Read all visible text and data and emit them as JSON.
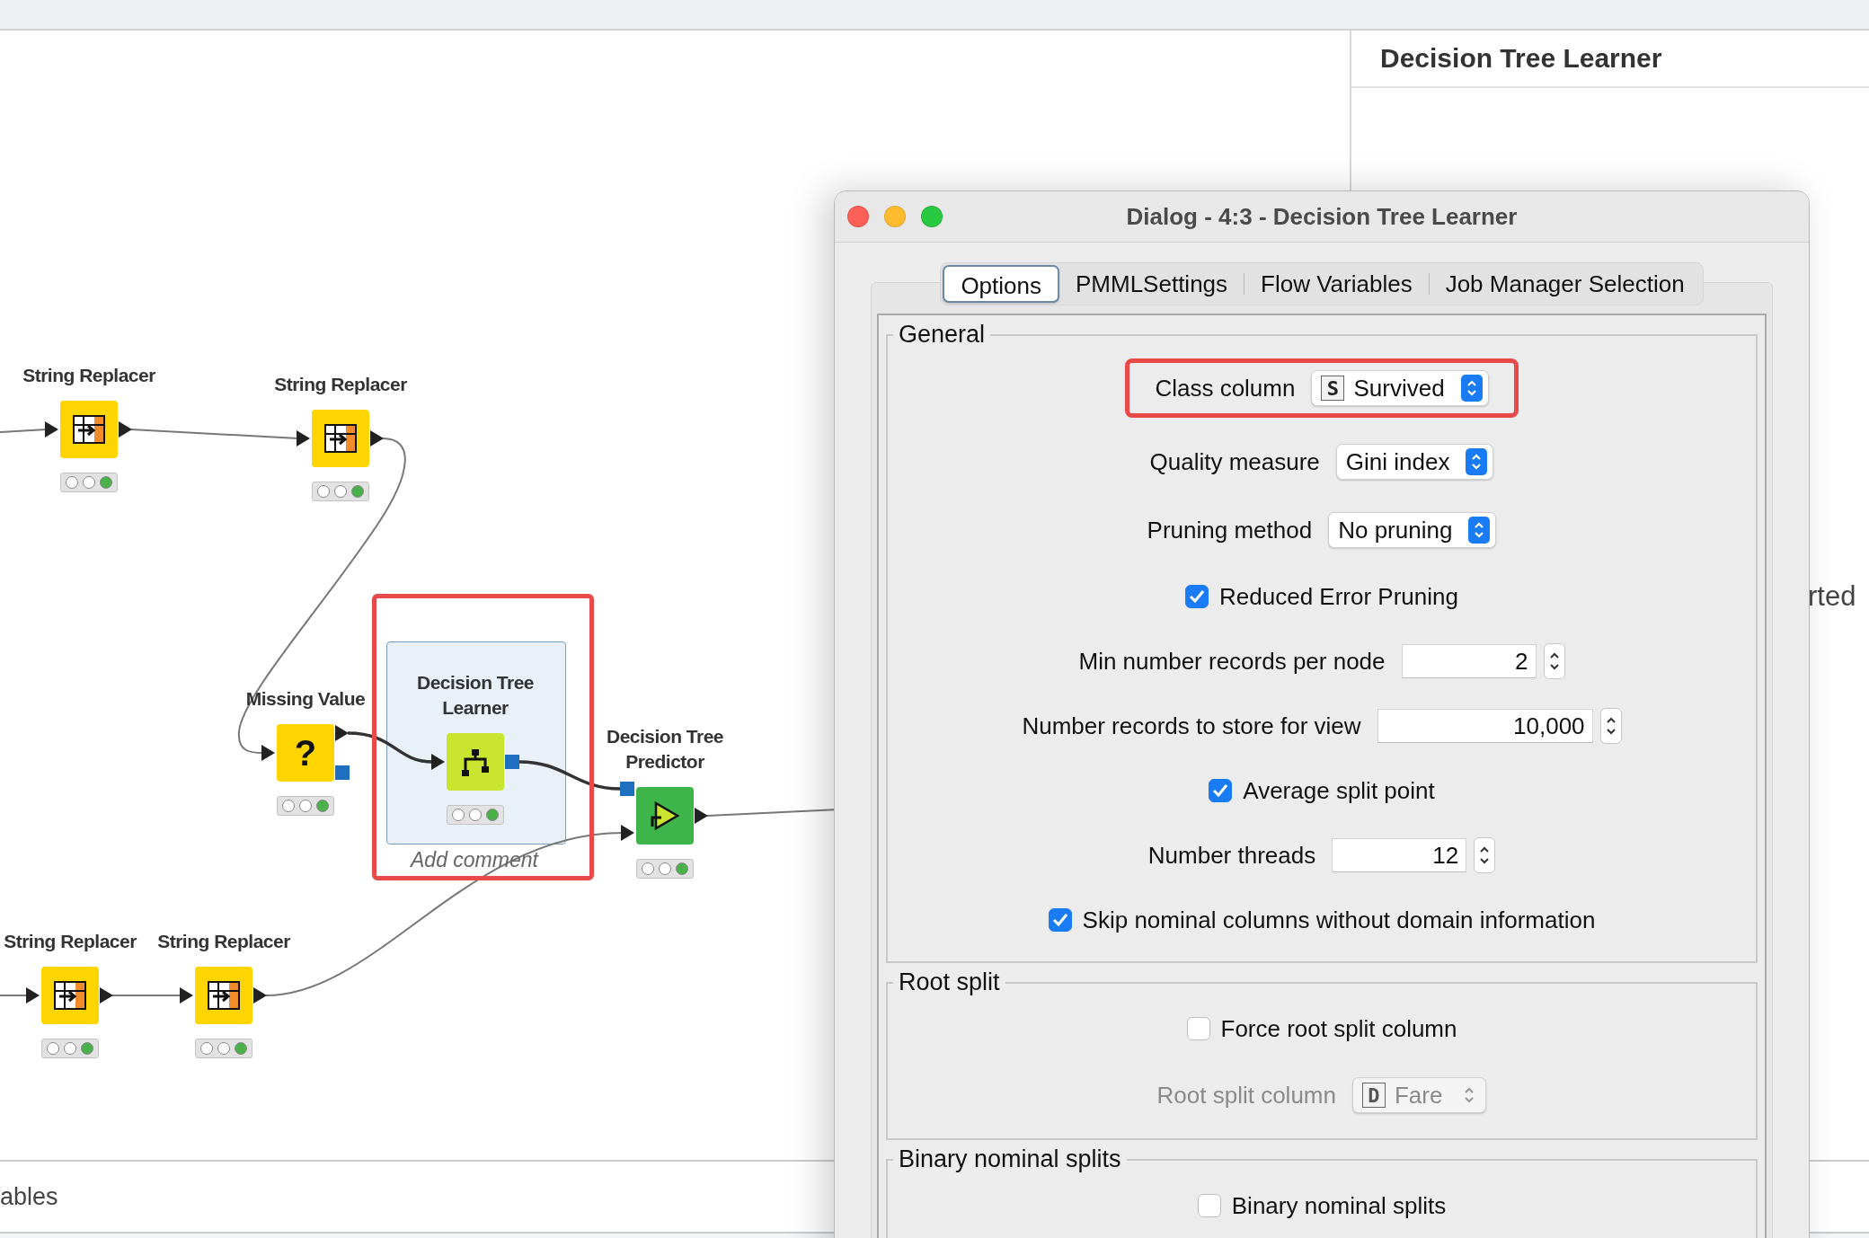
{
  "canvas": {
    "nodes": [
      {
        "kind": "string_replacer",
        "title": "String Replacer",
        "executed": true,
        "selected": false,
        "highlighted": false
      },
      {
        "kind": "string_replacer",
        "title": "String Replacer",
        "executed": true,
        "selected": false,
        "highlighted": false
      },
      {
        "kind": "missing_value",
        "title": "Missing Value",
        "glyph": "?",
        "executed": true,
        "selected": false,
        "highlighted": false
      },
      {
        "kind": "learner",
        "title": "Decision Tree Learner",
        "executed": true,
        "selected": true,
        "highlighted": true,
        "comment_placeholder": "Add comment"
      },
      {
        "kind": "predictor",
        "title": "Decision Tree Predictor",
        "executed": true,
        "selected": false,
        "highlighted": false
      },
      {
        "kind": "string_replacer",
        "title": "String Replacer",
        "executed": true,
        "selected": false,
        "highlighted": false
      },
      {
        "kind": "string_replacer",
        "title": "String Replacer",
        "executed": true,
        "selected": false,
        "highlighted": false
      }
    ]
  },
  "side_panel": {
    "title": "Decision Tree Learner",
    "text": "rted"
  },
  "bottom_panel": {
    "tab": "ables"
  },
  "dialog": {
    "title": "Dialog - 4:3 - Decision Tree Learner",
    "tabs": [
      {
        "label": "Options",
        "selected": true
      },
      {
        "label": "PMMLSettings",
        "selected": false
      },
      {
        "label": "Flow Variables",
        "selected": false
      },
      {
        "label": "Job Manager Selection",
        "selected": false
      }
    ],
    "sections": [
      {
        "title": "General",
        "rows": [
          {
            "kind": "select",
            "label": "Class column",
            "value": "Survived",
            "type_badge": "S",
            "highlighted": true,
            "disabled": false
          },
          {
            "kind": "select",
            "label": "Quality measure",
            "value": "Gini index",
            "highlighted": false,
            "disabled": false
          },
          {
            "kind": "select",
            "label": "Pruning method",
            "value": "No pruning",
            "highlighted": false,
            "disabled": false
          },
          {
            "kind": "checkbox",
            "label": "Reduced Error Pruning",
            "checked": true
          },
          {
            "kind": "spinner",
            "label": "Min number records per node",
            "value": "2"
          },
          {
            "kind": "spinner",
            "label": "Number records to store for view",
            "value": "10,000"
          },
          {
            "kind": "checkbox",
            "label": "Average split point",
            "checked": true
          },
          {
            "kind": "spinner",
            "label": "Number threads",
            "value": "12"
          },
          {
            "kind": "checkbox",
            "label": "Skip nominal columns without domain information",
            "checked": true
          }
        ]
      },
      {
        "title": "Root split",
        "rows": [
          {
            "kind": "checkbox",
            "label": "Force root split column",
            "checked": false
          },
          {
            "kind": "select",
            "label": "Root split column",
            "value": "Fare",
            "type_badge": "D",
            "highlighted": false,
            "disabled": true
          }
        ]
      },
      {
        "title": "Binary nominal splits",
        "rows": [
          {
            "kind": "checkbox",
            "label": "Binary nominal splits",
            "checked": false
          }
        ]
      }
    ]
  }
}
